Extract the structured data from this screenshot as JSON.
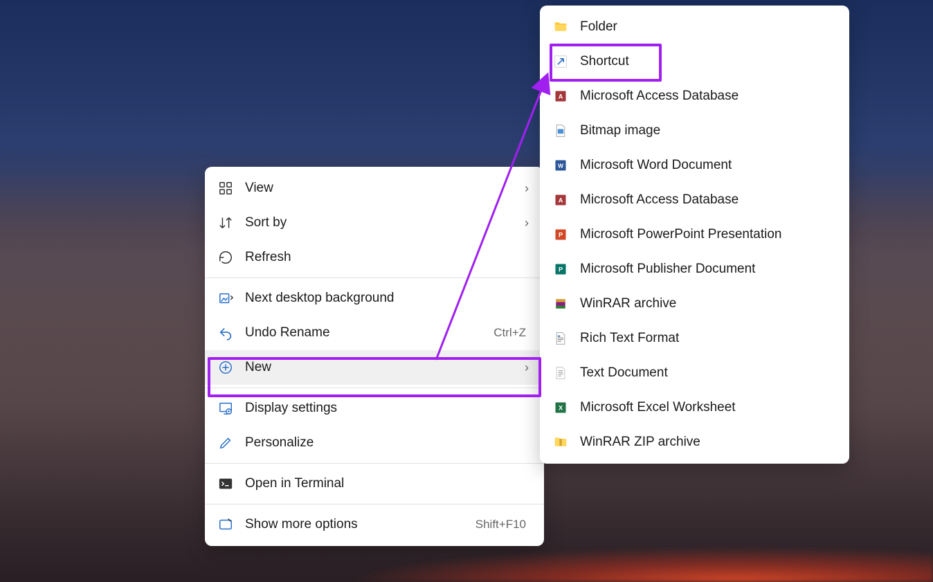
{
  "primaryMenu": {
    "items": [
      {
        "label": "View",
        "hasSubmenu": true
      },
      {
        "label": "Sort by",
        "hasSubmenu": true
      },
      {
        "label": "Refresh"
      }
    ],
    "items2": [
      {
        "label": "Next desktop background"
      },
      {
        "label": "Undo Rename",
        "shortcut": "Ctrl+Z"
      },
      {
        "label": "New",
        "hasSubmenu": true,
        "hovered": true
      }
    ],
    "items3": [
      {
        "label": "Display settings"
      },
      {
        "label": "Personalize"
      }
    ],
    "items4": [
      {
        "label": "Open in Terminal"
      }
    ],
    "items5": [
      {
        "label": "Show more options",
        "shortcut": "Shift+F10"
      }
    ]
  },
  "submenu": {
    "items": [
      {
        "label": "Folder",
        "icon": "folder"
      },
      {
        "label": "Shortcut",
        "icon": "shortcut"
      },
      {
        "label": "Microsoft Access Database",
        "icon": "access"
      },
      {
        "label": "Bitmap image",
        "icon": "bitmap"
      },
      {
        "label": "Microsoft Word Document",
        "icon": "word"
      },
      {
        "label": "Microsoft Access Database",
        "icon": "access2"
      },
      {
        "label": "Microsoft PowerPoint Presentation",
        "icon": "powerpoint"
      },
      {
        "label": "Microsoft Publisher Document",
        "icon": "publisher"
      },
      {
        "label": "WinRAR archive",
        "icon": "winrar"
      },
      {
        "label": "Rich Text Format",
        "icon": "rtf"
      },
      {
        "label": "Text Document",
        "icon": "text"
      },
      {
        "label": "Microsoft Excel Worksheet",
        "icon": "excel"
      },
      {
        "label": "WinRAR ZIP archive",
        "icon": "zip"
      }
    ]
  },
  "annotation": {
    "highlightColor": "#a020f0"
  }
}
